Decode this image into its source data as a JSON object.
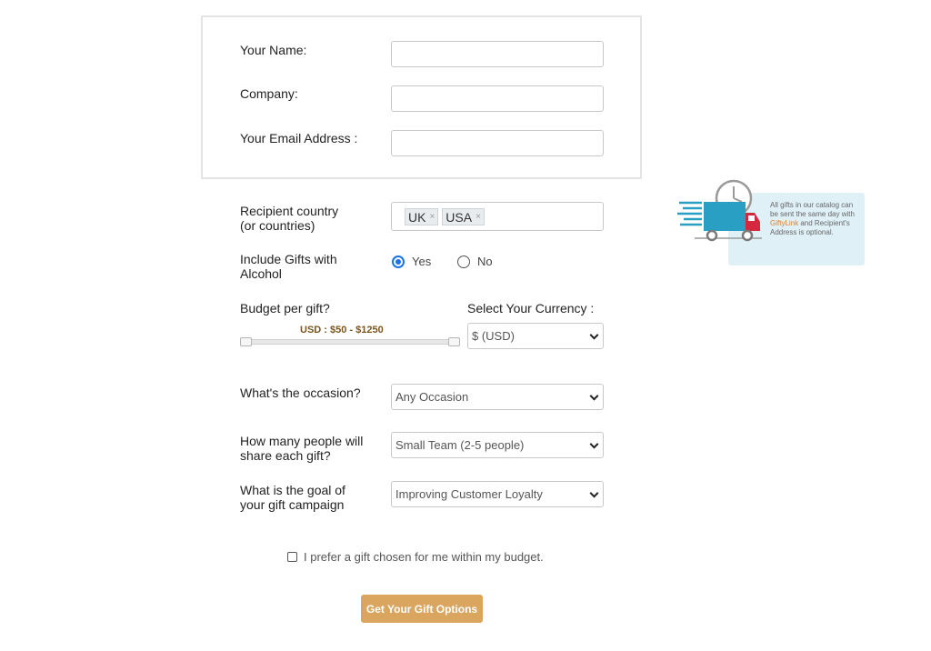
{
  "contact": {
    "name_label": "Your Name:",
    "company_label": "Company:",
    "email_label": "Your Email Address :",
    "name_value": "",
    "company_value": "",
    "email_value": ""
  },
  "recipient": {
    "label_line1": "Recipient country",
    "label_line2": "(or countries)",
    "tags": [
      "UK",
      "USA"
    ],
    "remove_glyph": "×"
  },
  "alcohol": {
    "label_line1": "Include Gifts with",
    "label_line2": "Alcohol",
    "yes": "Yes",
    "no": "No",
    "selected": "Yes"
  },
  "budget": {
    "label": "Budget per gift?",
    "range_text": "USD : $50 - $1250",
    "min": 50,
    "max": 1250
  },
  "currency": {
    "label": "Select Your Currency :",
    "value": "$ (USD)"
  },
  "occasion": {
    "label": "What's the occasion?",
    "value": "Any Occasion"
  },
  "sharing": {
    "label_line1": "How many people will",
    "label_line2": "share each gift?",
    "value": "Small Team (2-5 people)"
  },
  "goal": {
    "label_line1": "What is the goal of",
    "label_line2": "your gift campaign",
    "value": "Improving Customer Loyalty"
  },
  "checkbox": {
    "label": "I prefer a gift chosen for me within my budget.",
    "checked": false
  },
  "submit": {
    "label": "Get Your Gift Options"
  },
  "delivery_note": {
    "text_before": "All gifts in our catalog can be sent the same day with ",
    "brand": "GiftyLink",
    "text_after": " and Recipient's Address is optional."
  },
  "colors": {
    "button": "#d9a55f",
    "note_bg": "#dff0f7",
    "truck_blue": "#2a9fc4",
    "truck_red": "#d5283e",
    "radio_blue": "#1a73e8"
  }
}
